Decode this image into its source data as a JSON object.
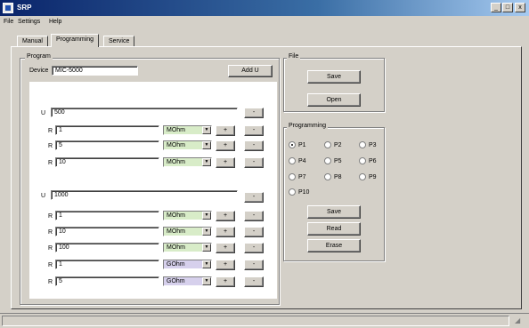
{
  "window": {
    "title": "SRP",
    "min_label": "_",
    "max_label": "□",
    "close_label": "x"
  },
  "menu": {
    "file": "File",
    "settings": "Settings",
    "help": "Help"
  },
  "tabs": {
    "manual": "Manual",
    "programming": "Programming",
    "service": "Service"
  },
  "program": {
    "group_title": "Program",
    "device_label": "Device",
    "device_value": "MIC-5000",
    "add_u_label": "Add U",
    "blocks": [
      {
        "u_label": "U",
        "u_value": "500",
        "minus": "-",
        "rows": [
          {
            "label": "R",
            "value": "1",
            "unit": "MOhm",
            "plus": "+",
            "minus": "-"
          },
          {
            "label": "R",
            "value": "5",
            "unit": "MOhm",
            "plus": "+",
            "minus": "-"
          },
          {
            "label": "R",
            "value": "10",
            "unit": "MOhm",
            "plus": "+",
            "minus": "-"
          }
        ]
      },
      {
        "u_label": "U",
        "u_value": "1000",
        "minus": "-",
        "rows": [
          {
            "label": "R",
            "value": "1",
            "unit": "MOhm",
            "plus": "+",
            "minus": "-"
          },
          {
            "label": "R",
            "value": "10",
            "unit": "MOhm",
            "plus": "+",
            "minus": "-"
          },
          {
            "label": "R",
            "value": "100",
            "unit": "MOhm",
            "plus": "+",
            "minus": "-"
          },
          {
            "label": "R",
            "value": "1",
            "unit": "GOhm",
            "plus": "+",
            "minus": "-"
          },
          {
            "label": "R",
            "value": "5",
            "unit": "GOhm",
            "plus": "+",
            "minus": "-"
          }
        ]
      }
    ]
  },
  "file_group": {
    "title": "File",
    "save": "Save",
    "open": "Open"
  },
  "programming_group": {
    "title": "Programming",
    "options": [
      "P1",
      "P2",
      "P3",
      "P4",
      "P5",
      "P6",
      "P7",
      "P8",
      "P9",
      "P10"
    ],
    "selected": "P1",
    "save": "Save",
    "read": "Read",
    "erase": "Erase"
  },
  "colors": {
    "mohm_bg": "#d8ecc8",
    "gohm_bg": "#d6d0ec",
    "titlebar": "#0a246a",
    "face": "#d4d0c8"
  }
}
